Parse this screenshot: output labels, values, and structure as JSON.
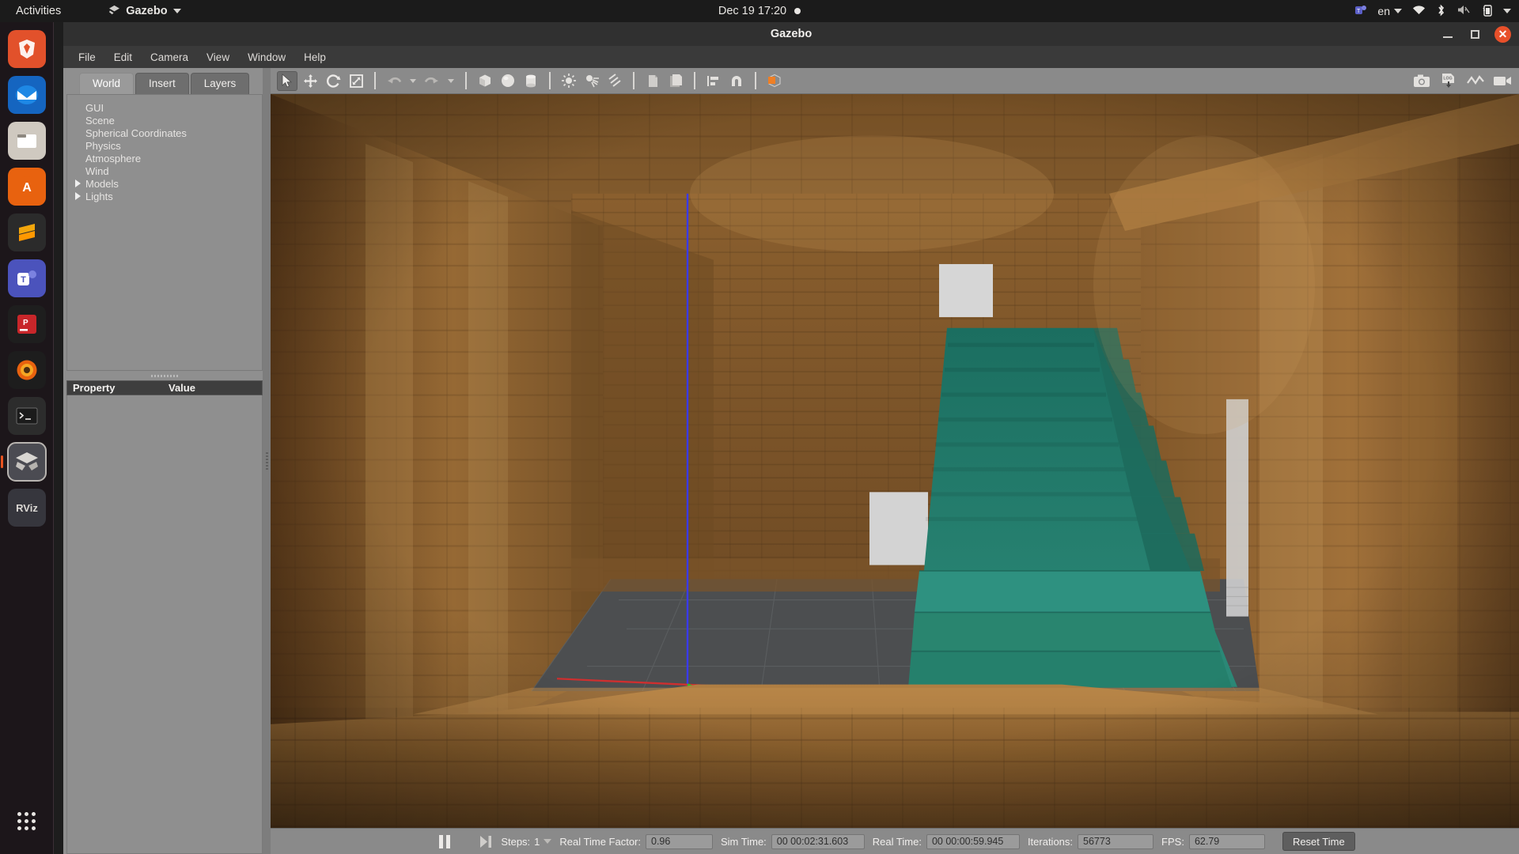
{
  "desktop": {
    "activities": "Activities",
    "app_menu": "Gazebo",
    "clock": "Dec 19  17:20",
    "language": "en",
    "tray_icons": [
      "teams-icon",
      "language-indicator",
      "wifi-icon",
      "bluetooth-icon",
      "volume-muted-icon",
      "battery-icon",
      "system-menu-caret"
    ]
  },
  "dock": {
    "items": [
      {
        "name": "brave-browser",
        "glyph": "◆",
        "color": "#e2512b"
      },
      {
        "name": "thunderbird-mail",
        "glyph": "✉",
        "color": "#2b6fd6"
      },
      {
        "name": "files-nautilus",
        "glyph": "▮",
        "color": "#d8d2c8"
      },
      {
        "name": "ubuntu-software",
        "glyph": "A",
        "color": "#e8620f"
      },
      {
        "name": "sublime-text",
        "glyph": "S",
        "color": "#f2a60c"
      },
      {
        "name": "microsoft-teams",
        "glyph": "T",
        "color": "#5b5fc7"
      },
      {
        "name": "pycharm",
        "glyph": "▣",
        "color": "#c8262a"
      },
      {
        "name": "firefox",
        "glyph": "●",
        "color": "#e86321"
      },
      {
        "name": "terminal",
        "glyph": ">_",
        "color": "#2d2d2d"
      },
      {
        "name": "gazebo",
        "glyph": "⬟",
        "color": "#4b4b52"
      },
      {
        "name": "rviz",
        "glyph": "RViz",
        "color": "#3d3d44"
      }
    ],
    "show_apps": "show-applications"
  },
  "window": {
    "title": "Gazebo",
    "controls": [
      "minimize",
      "maximize",
      "close"
    ]
  },
  "menubar": {
    "items": [
      "File",
      "Edit",
      "Camera",
      "View",
      "Window",
      "Help"
    ]
  },
  "left_panel": {
    "tabs": [
      {
        "label": "World",
        "active": true
      },
      {
        "label": "Insert",
        "active": false
      },
      {
        "label": "Layers",
        "active": false
      }
    ],
    "tree": [
      {
        "label": "GUI",
        "expandable": false
      },
      {
        "label": "Scene",
        "expandable": false
      },
      {
        "label": "Spherical Coordinates",
        "expandable": false
      },
      {
        "label": "Physics",
        "expandable": false
      },
      {
        "label": "Atmosphere",
        "expandable": false
      },
      {
        "label": "Wind",
        "expandable": false
      },
      {
        "label": "Models",
        "expandable": true
      },
      {
        "label": "Lights",
        "expandable": true
      }
    ],
    "property_header": {
      "property": "Property",
      "value": "Value"
    }
  },
  "toolbar": {
    "left_tools": [
      {
        "name": "select-mode-button",
        "active": true
      },
      {
        "name": "translate-mode-button",
        "active": false
      },
      {
        "name": "rotate-mode-button",
        "active": false
      },
      {
        "name": "scale-mode-button",
        "active": false
      },
      {
        "name": "undo-button",
        "active": false
      },
      {
        "name": "redo-button",
        "active": false
      },
      {
        "name": "insert-box-button",
        "active": false
      },
      {
        "name": "insert-sphere-button",
        "active": false
      },
      {
        "name": "insert-cylinder-button",
        "active": false
      },
      {
        "name": "point-light-button",
        "active": false
      },
      {
        "name": "spot-light-button",
        "active": false
      },
      {
        "name": "directional-light-button",
        "active": false
      },
      {
        "name": "copy-button",
        "active": false
      },
      {
        "name": "paste-button",
        "active": false
      },
      {
        "name": "align-button",
        "active": false
      },
      {
        "name": "snap-button",
        "active": false
      },
      {
        "name": "change-view-button",
        "active": false
      }
    ],
    "right_tools": [
      {
        "name": "screenshot-button"
      },
      {
        "name": "log-record-button"
      },
      {
        "name": "plot-button"
      },
      {
        "name": "video-record-button"
      }
    ],
    "log_label": "LOG"
  },
  "statusbar": {
    "pause_button": "pause",
    "step_button": "step-forward",
    "steps_label": "Steps:",
    "steps_value": "1",
    "rtf_label": "Real Time Factor:",
    "rtf_value": "0.96",
    "sim_time_label": "Sim Time:",
    "sim_time_value": "00 00:02:31.603",
    "real_time_label": "Real Time:",
    "real_time_value": "00 00:00:59.945",
    "iterations_label": "Iterations:",
    "iterations_value": "56773",
    "fps_label": "FPS:",
    "fps_value": "62.79",
    "reset_label": "Reset Time"
  },
  "viewport": {
    "scene_description": "indoor wooden corridor with teal staircase",
    "colors": {
      "wood_light": "#a8753c",
      "wood_mid": "#8a5c2c",
      "wood_dark": "#5d3c1b",
      "stairs_teal": "#1f7a6b",
      "floor_gray": "#4c4e50",
      "panel_white": "#d8d8d8"
    },
    "axis_markers": [
      "z-axis-blue",
      "x-axis-red",
      "y-axis-green"
    ]
  }
}
